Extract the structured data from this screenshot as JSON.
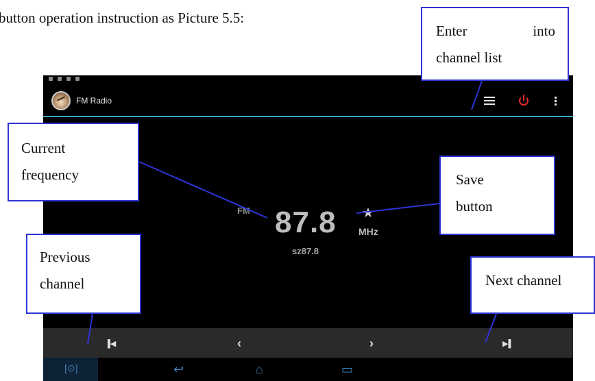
{
  "document": {
    "intro_text": "button operation instruction as Picture 5.5:"
  },
  "callouts": {
    "channel_list": {
      "line1": [
        "Enter",
        "into"
      ],
      "line2": "channel list"
    },
    "current_frequency": {
      "line1": "Current",
      "line2": "frequency"
    },
    "save_button": {
      "line1": "Save",
      "line2": "button"
    },
    "previous_channel": {
      "line1": "Previous",
      "line2": "channel"
    },
    "next_channel": {
      "line1": "Next channel"
    }
  },
  "app": {
    "title": "FM Radio",
    "band": "FM",
    "frequency": "87.8",
    "unit": "MHz",
    "station_name": "sz87.8",
    "icons": [
      "fm-radio-app-icon",
      "channel-list-icon",
      "power-icon",
      "overflow-menu-icon",
      "star-icon",
      "skip-previous-icon",
      "chevron-left-icon",
      "chevron-right-icon",
      "skip-next-icon",
      "nav-back-icon",
      "nav-home-icon",
      "nav-recent-apps-icon",
      "screenshot-icon"
    ],
    "colors": {
      "accent": "#35a9c9",
      "power": "#e52b2b",
      "nav": "#3f7fb8",
      "callout_border": "#2d35d6"
    }
  }
}
